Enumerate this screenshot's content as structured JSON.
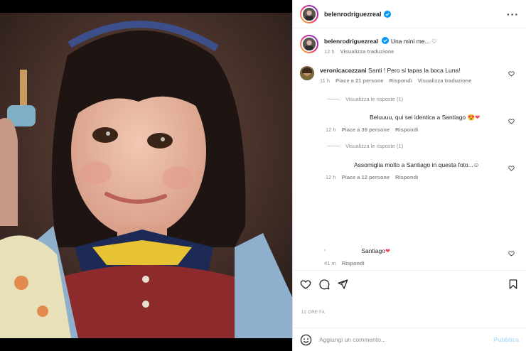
{
  "post": {
    "author": "belenrodriguezreal",
    "more_icon": "more-dots-icon",
    "verified_color": "#0095f6"
  },
  "caption": {
    "author": "belenrodriguezreal",
    "text": "Una mini me... ♡",
    "time": "12 h",
    "translate": "Visualizza traduzione"
  },
  "comments": [
    {
      "author": "veronicacozzani",
      "text": "Santi ! Pero si tapas la boca Luna!",
      "time": "11 h",
      "likes": "Piace a 21 persone",
      "reply": "Rispondi",
      "translate": "Visualizza traduzione",
      "replies_toggle": "Visualizza le risposte (1)"
    },
    {
      "author": "",
      "text": "Beluuuu, qui sei identica a Santiago 😍",
      "time": "12 h",
      "likes": "Piace a 39 persone",
      "reply": "Rispondi",
      "replies_toggle": "Visualizza le risposte (1)"
    },
    {
      "author": "",
      "text": "Assomiglia molto a Santiago in questa foto...☺",
      "time": "12 h",
      "likes": "Piace a 12 persone",
      "reply": "Rispondi"
    },
    {
      "author": "",
      "text": "Santiago",
      "time": "41 m",
      "reply": "Rispondi"
    }
  ],
  "actions": {
    "like_icon": "heart-icon",
    "comment_icon": "comment-icon",
    "share_icon": "share-icon",
    "save_icon": "bookmark-icon"
  },
  "timestamp": "12 ORE FA",
  "composer": {
    "placeholder": "Aggiungi un commento...",
    "publish": "Pubblica",
    "emoji_icon": "emoji-icon"
  },
  "colors": {
    "heart_red": "#ed4956",
    "muted": "#8e8e8e",
    "publish_disabled": "#b2dffc"
  }
}
